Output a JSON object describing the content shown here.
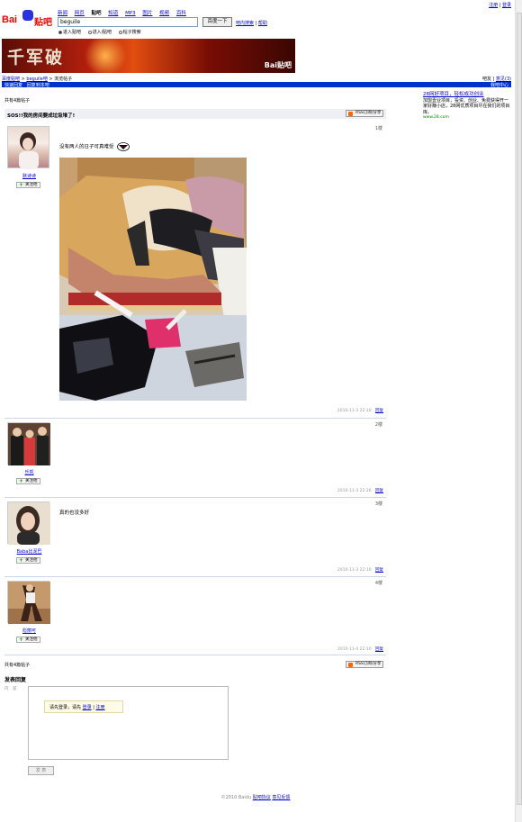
{
  "header": {
    "top_links": [
      "注册",
      "登录"
    ],
    "logo_text": "Bai",
    "logo_suffix": "贴吧",
    "nav": [
      "新闻",
      "网页",
      "贴吧",
      "知道",
      "MP3",
      "图片",
      "视频",
      "百科"
    ],
    "nav_current": 2,
    "search_value": "beguile",
    "search_button": "百度一下",
    "search_links": [
      "吧内搜索",
      "帮助"
    ],
    "radios": [
      "进入贴吧",
      "进入i贴吧",
      "帖子搜索"
    ],
    "radio_selected": 0
  },
  "banner": {
    "title": "千军破",
    "brand": "Bai贴吧"
  },
  "breadcrumb": {
    "items": [
      "百度贴吧",
      "beguile吧"
    ],
    "current": "浏览帖子"
  },
  "toplinks2": [
    "吧友",
    "意见(3)"
  ],
  "bluebar": {
    "left": [
      "快速回复",
      "回复到本吧"
    ],
    "right": "我吧中心"
  },
  "thread": {
    "count_top": "共有4篇帖子",
    "title": "SOS!!我的房间要成垃圾堆了!",
    "reply_btn": "RSS订阅/分享",
    "count_bottom": "共有4篇帖子"
  },
  "posts": [
    {
      "floor": "1楼",
      "user": "默诗诗",
      "follow": "关注他",
      "text": "没有两人的日子可真难受",
      "time": "2010-11-3 22:10",
      "reply": "回复"
    },
    {
      "floor": "2楼",
      "user": "乐凯",
      "follow": "关注他",
      "text": "",
      "time": "2010-11-3 22:26",
      "reply": "回复"
    },
    {
      "floor": "3楼",
      "user": "Baba比泥巴",
      "follow": "关注他",
      "text": "真的也没多好",
      "time": "2010-11-3 22:10",
      "reply": "回复"
    },
    {
      "floor": "4楼",
      "user": "彪丽可",
      "follow": "关注他",
      "text": "",
      "time": "2010-11-4 22:10",
      "reply": "回复"
    }
  ],
  "sidebar": {
    "title": "28网好项目，轻松成功创业",
    "body": "加盟壹业项目，投资、创业、免费获得开一家好赚小店，28网优质项目尽在我们的项目库。",
    "url": "www.28.com"
  },
  "reply_form": {
    "heading": "发表回复",
    "label": "内　容",
    "tip_prefix": "请先登录，请先",
    "tip_login": "登录",
    "tip_sep": "|",
    "tip_register": "注册",
    "submit": "发 表"
  },
  "footer": {
    "copyright": "©2010 Baidu",
    "links": [
      "贴吧协议",
      "意见反馈"
    ]
  },
  "colors": {
    "brand_red": "#e10602",
    "link_blue": "#0000cc",
    "bar_blue": "#0033cc"
  }
}
